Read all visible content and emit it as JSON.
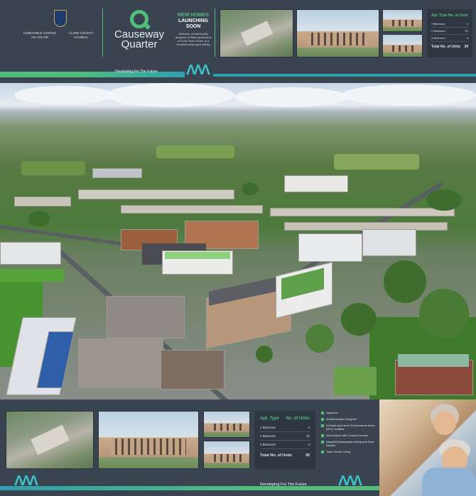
{
  "council": {
    "left_name": "COMHAIRLE CONTAE AN CHLÁIR",
    "right_name": "CLARE COUNTY COUNCIL"
  },
  "brand": {
    "name_line1": "Causeway",
    "name_line2": "Quarter",
    "accent_color": "#4fc07b"
  },
  "launch": {
    "line1": "NEW HOMES",
    "line2": "LAUNCHING",
    "line3": "SOON",
    "blurb": "Attractive, architecturally designed, A Rated apartments in Ennis Town Centre, in a beautiful landscaped setting"
  },
  "tagline": "Developing For The Future",
  "units_table": {
    "col_type": "Apt. Type",
    "col_units": "No. of Units",
    "rows": [
      {
        "type": "1 Bedroom",
        "units": "4"
      },
      {
        "type": "2 Bedroom",
        "units": "31"
      },
      {
        "type": "3 Bedroom",
        "units": "4"
      }
    ],
    "total_label": "Total No. of Units",
    "total_value": "39"
  },
  "features": [
    "Spacious",
    "Architecturally Designed",
    "A Rated and Home Performance Index (HPI) Certified",
    "Dual Aspect with Corridor Access",
    "Beautiful landscaped setting and Roof Garden",
    "Town Centre Living"
  ],
  "icons": {
    "crest": "council-crest-icon",
    "logo": "q-logo-icon",
    "waves": "wave-logo-icon"
  }
}
